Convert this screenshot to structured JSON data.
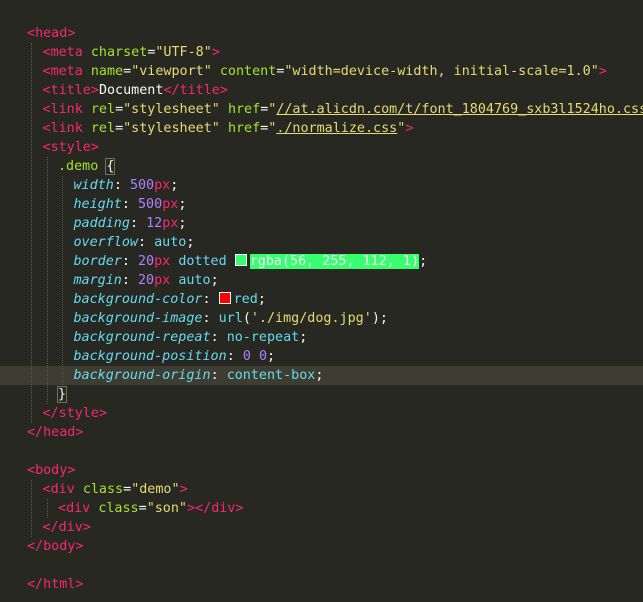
{
  "lines": [
    {
      "indent": 0,
      "tokens": [
        [
          "t",
          "<"
        ],
        [
          "t",
          "head"
        ],
        [
          "t",
          ">"
        ]
      ]
    },
    {
      "indent": 1,
      "tokens": [
        [
          "t",
          "<"
        ],
        [
          "t",
          "meta"
        ],
        [
          "w",
          " "
        ],
        [
          "a",
          "charset"
        ],
        [
          "w",
          "="
        ],
        [
          "s",
          "\"UTF-8\""
        ],
        [
          "t",
          ">"
        ]
      ]
    },
    {
      "indent": 1,
      "tokens": [
        [
          "t",
          "<"
        ],
        [
          "t",
          "meta"
        ],
        [
          "w",
          " "
        ],
        [
          "a",
          "name"
        ],
        [
          "w",
          "="
        ],
        [
          "s",
          "\"viewport\""
        ],
        [
          "w",
          " "
        ],
        [
          "a",
          "content"
        ],
        [
          "w",
          "="
        ],
        [
          "s",
          "\"width=device-width, initial-scale=1.0\""
        ],
        [
          "t",
          ">"
        ]
      ]
    },
    {
      "indent": 1,
      "tokens": [
        [
          "t",
          "<"
        ],
        [
          "t",
          "title"
        ],
        [
          "t",
          ">"
        ],
        [
          "w",
          "Document"
        ],
        [
          "t",
          "</"
        ],
        [
          "t",
          "title"
        ],
        [
          "t",
          ">"
        ]
      ]
    },
    {
      "indent": 1,
      "tokens": [
        [
          "t",
          "<"
        ],
        [
          "t",
          "link"
        ],
        [
          "w",
          " "
        ],
        [
          "a",
          "rel"
        ],
        [
          "w",
          "="
        ],
        [
          "s",
          "\"stylesheet\""
        ],
        [
          "w",
          " "
        ],
        [
          "a",
          "href"
        ],
        [
          "w",
          "="
        ],
        [
          "s",
          "\""
        ],
        [
          "su",
          "//at.alicdn.com/t/font_1804769_sxb3l1524ho.css"
        ],
        [
          "s",
          "\""
        ],
        [
          "t",
          ">"
        ]
      ]
    },
    {
      "indent": 1,
      "tokens": [
        [
          "t",
          "<"
        ],
        [
          "t",
          "link"
        ],
        [
          "w",
          " "
        ],
        [
          "a",
          "rel"
        ],
        [
          "w",
          "="
        ],
        [
          "s",
          "\"stylesheet\""
        ],
        [
          "w",
          " "
        ],
        [
          "a",
          "href"
        ],
        [
          "w",
          "="
        ],
        [
          "s",
          "\""
        ],
        [
          "su",
          "./normalize.css"
        ],
        [
          "s",
          "\""
        ],
        [
          "t",
          ">"
        ]
      ]
    },
    {
      "indent": 1,
      "tokens": [
        [
          "t",
          "<"
        ],
        [
          "t",
          "style"
        ],
        [
          "t",
          ">"
        ]
      ]
    },
    {
      "indent": 2,
      "tokens": [
        [
          "a",
          ".demo"
        ],
        [
          "w",
          " "
        ],
        [
          "wb",
          "{"
        ]
      ]
    },
    {
      "indent": 3,
      "tokens": [
        [
          "p",
          "width"
        ],
        [
          "w",
          ": "
        ],
        [
          "n",
          "500"
        ],
        [
          "k",
          "px"
        ],
        [
          "w",
          ";"
        ]
      ]
    },
    {
      "indent": 3,
      "tokens": [
        [
          "p",
          "height"
        ],
        [
          "w",
          ": "
        ],
        [
          "n",
          "500"
        ],
        [
          "k",
          "px"
        ],
        [
          "w",
          ";"
        ]
      ]
    },
    {
      "indent": 3,
      "tokens": [
        [
          "p",
          "padding"
        ],
        [
          "w",
          ": "
        ],
        [
          "n",
          "12"
        ],
        [
          "k",
          "px"
        ],
        [
          "w",
          ";"
        ]
      ]
    },
    {
      "indent": 3,
      "tokens": [
        [
          "p",
          "overflow"
        ],
        [
          "w",
          ": "
        ],
        [
          "v",
          "auto"
        ],
        [
          "w",
          ";"
        ]
      ]
    },
    {
      "indent": 3,
      "tokens": [
        [
          "p",
          "border"
        ],
        [
          "w",
          ": "
        ],
        [
          "n",
          "20"
        ],
        [
          "k",
          "px"
        ],
        [
          "w",
          " "
        ],
        [
          "v",
          "dotted"
        ],
        [
          "w",
          " "
        ],
        [
          "sw",
          "#38ff70"
        ],
        [
          "hl",
          "rgba(56, 255, 112, 1)"
        ],
        [
          "w",
          ";"
        ]
      ]
    },
    {
      "indent": 3,
      "tokens": [
        [
          "p",
          "margin"
        ],
        [
          "w",
          ": "
        ],
        [
          "n",
          "20"
        ],
        [
          "k",
          "px"
        ],
        [
          "w",
          " "
        ],
        [
          "v",
          "auto"
        ],
        [
          "w",
          ";"
        ]
      ]
    },
    {
      "indent": 3,
      "tokens": [
        [
          "p",
          "background-color"
        ],
        [
          "w",
          ": "
        ],
        [
          "sw",
          "#ff0000"
        ],
        [
          "v",
          "red"
        ],
        [
          "w",
          ";"
        ]
      ]
    },
    {
      "indent": 3,
      "tokens": [
        [
          "p",
          "background-image"
        ],
        [
          "w",
          ": "
        ],
        [
          "v",
          "url"
        ],
        [
          "w",
          "("
        ],
        [
          "s",
          "'./img/dog.jpg'"
        ],
        [
          "w",
          ");"
        ]
      ]
    },
    {
      "indent": 3,
      "tokens": [
        [
          "p",
          "background-repeat"
        ],
        [
          "w",
          ": "
        ],
        [
          "v",
          "no-repeat"
        ],
        [
          "w",
          ";"
        ]
      ]
    },
    {
      "indent": 3,
      "tokens": [
        [
          "p",
          "background-position"
        ],
        [
          "w",
          ": "
        ],
        [
          "n",
          "0"
        ],
        [
          "w",
          " "
        ],
        [
          "n",
          "0"
        ],
        [
          "w",
          ";"
        ]
      ]
    },
    {
      "indent": 3,
      "active": true,
      "tokens": [
        [
          "p",
          "background-origin"
        ],
        [
          "w",
          ": "
        ],
        [
          "v",
          "content-box"
        ],
        [
          "w",
          ";"
        ]
      ]
    },
    {
      "indent": 2,
      "tokens": [
        [
          "wb",
          "}"
        ]
      ]
    },
    {
      "indent": 1,
      "tokens": [
        [
          "t",
          "</"
        ],
        [
          "t",
          "style"
        ],
        [
          "t",
          ">"
        ]
      ]
    },
    {
      "indent": 0,
      "tokens": [
        [
          "t",
          "</"
        ],
        [
          "t",
          "head"
        ],
        [
          "t",
          ">"
        ]
      ]
    },
    {
      "indent": 0,
      "tokens": []
    },
    {
      "indent": 0,
      "tokens": [
        [
          "t",
          "<"
        ],
        [
          "t",
          "body"
        ],
        [
          "t",
          ">"
        ]
      ]
    },
    {
      "indent": 1,
      "tokens": [
        [
          "t",
          "<"
        ],
        [
          "t",
          "div"
        ],
        [
          "w",
          " "
        ],
        [
          "a",
          "class"
        ],
        [
          "w",
          "="
        ],
        [
          "s",
          "\"demo\""
        ],
        [
          "t",
          ">"
        ]
      ]
    },
    {
      "indent": 2,
      "tokens": [
        [
          "t",
          "<"
        ],
        [
          "t",
          "div"
        ],
        [
          "w",
          " "
        ],
        [
          "a",
          "class"
        ],
        [
          "w",
          "="
        ],
        [
          "s",
          "\"son\""
        ],
        [
          "t",
          "></"
        ],
        [
          "t",
          "div"
        ],
        [
          "t",
          ">"
        ]
      ]
    },
    {
      "indent": 1,
      "tokens": [
        [
          "t",
          "</"
        ],
        [
          "t",
          "div"
        ],
        [
          "t",
          ">"
        ]
      ]
    },
    {
      "indent": 0,
      "tokens": [
        [
          "t",
          "</"
        ],
        [
          "t",
          "body"
        ],
        [
          "t",
          ">"
        ]
      ]
    },
    {
      "indent": 0,
      "tokens": []
    },
    {
      "indent": 0,
      "tokens": [
        [
          "t",
          "</"
        ],
        [
          "t",
          "html"
        ],
        [
          "t",
          ">"
        ]
      ]
    }
  ]
}
